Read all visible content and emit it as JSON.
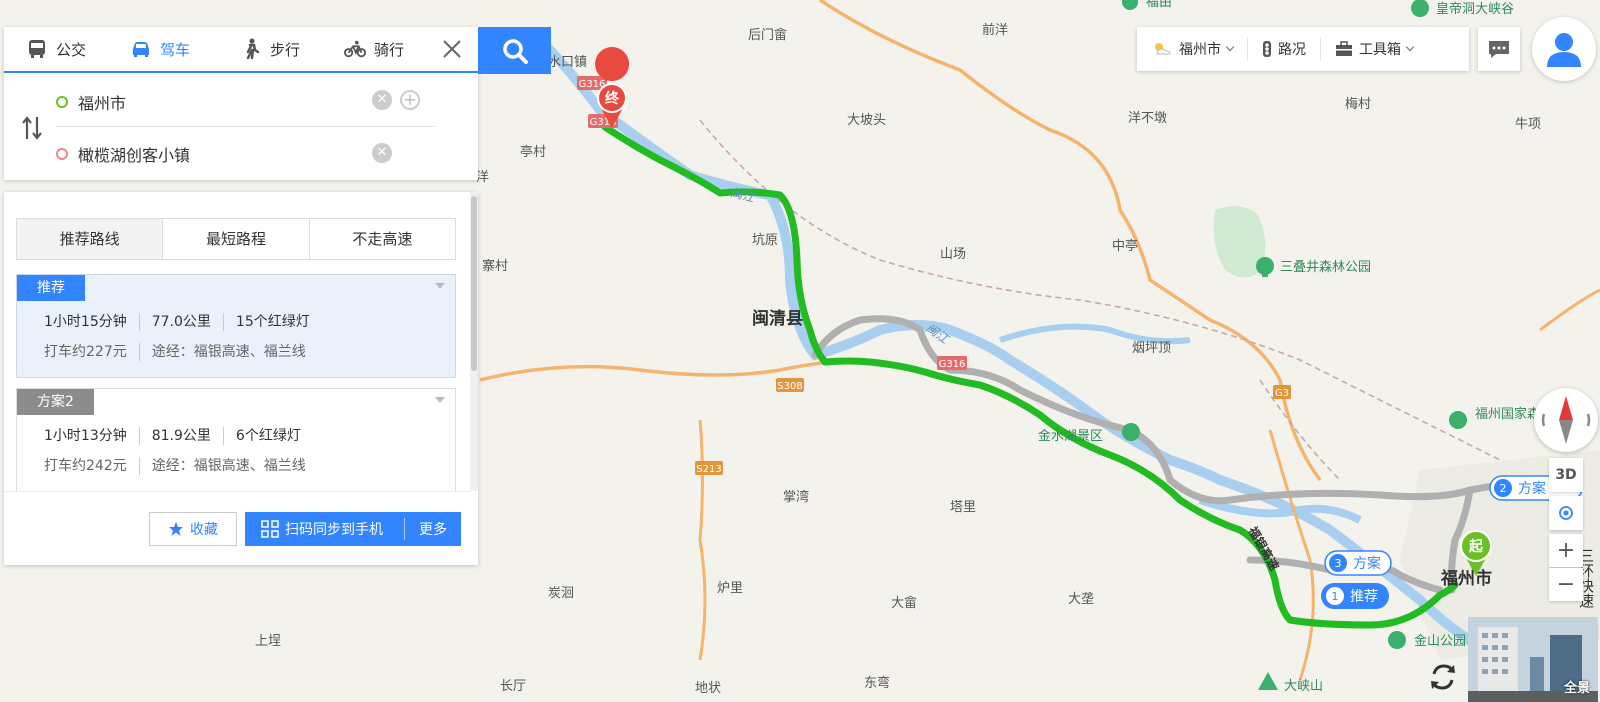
{
  "mode_tabs": [
    {
      "label": "公交"
    },
    {
      "label": "驾车"
    },
    {
      "label": "步行"
    },
    {
      "label": "骑行"
    }
  ],
  "route": {
    "start_value": "福州市",
    "end_value": "橄榄湖创客小镇"
  },
  "route_tabs": [
    "推荐路线",
    "最短路程",
    "不走高速"
  ],
  "plans": [
    {
      "tag": "推荐",
      "tag_color": "#3385ff",
      "time": "1小时15分钟",
      "distance": "77.0公里",
      "lights": "15个红绿灯",
      "taxi": "打车约227元",
      "via": "途经：福银高速、福兰线"
    },
    {
      "tag": "方案2",
      "tag_color": "#8c8c8c",
      "time": "1小时13分钟",
      "distance": "81.9公里",
      "lights": "6个红绿灯",
      "taxi": "打车约242元",
      "via": "途经：福银高速、福兰线"
    }
  ],
  "footer": {
    "favorite": "收藏",
    "sync": "扫码同步到手机",
    "more": "更多"
  },
  "toolbar": {
    "city": "福州市",
    "traffic": "路况",
    "tools": "工具箱"
  },
  "map_controls": {
    "three_d": "3D",
    "zoom_in": "+",
    "zoom_out": "−",
    "panorama": "全景"
  },
  "map_labels": {
    "places": [
      "后门畲",
      "前洋",
      "大坡头",
      "洋不墩",
      "梅村",
      "牛项",
      "亭村",
      "坑原",
      "山场",
      "中亭",
      "寨村",
      "烟坪顶",
      "塔里",
      "掌湾",
      "炭洄",
      "炉里",
      "大畲",
      "大垄",
      "上埕",
      "长厅",
      "地状",
      "东弯",
      "水口镇",
      "洋"
    ],
    "county": "闽清县",
    "city": "福州市",
    "parks": [
      "三叠井森林公园",
      "金水湖景区",
      "福州国家森林公园",
      "金山公园",
      "大峡山",
      "皇帝洞大峡谷",
      "福由"
    ],
    "rivers": [
      "闽江",
      "闽江"
    ],
    "roads": [
      "G316",
      "G316",
      "G316",
      "S308",
      "S213",
      "G3",
      "G316",
      "G316"
    ],
    "expressway": "福银高速",
    "start_marker": "起",
    "end_marker": "终",
    "route_tags": [
      {
        "num": "1",
        "label": "推荐"
      },
      {
        "num": "2",
        "label": "方案"
      },
      {
        "num": "3",
        "label": "方案"
      }
    ],
    "edge_text": "三环快速"
  },
  "colors": {
    "primary": "#3385ff",
    "route_recommended": "#22bb22",
    "route_alt": "#b0b0b0",
    "river": "#a9cff0",
    "highway": "#f5b46c",
    "green_area": "#c8e8cc"
  }
}
